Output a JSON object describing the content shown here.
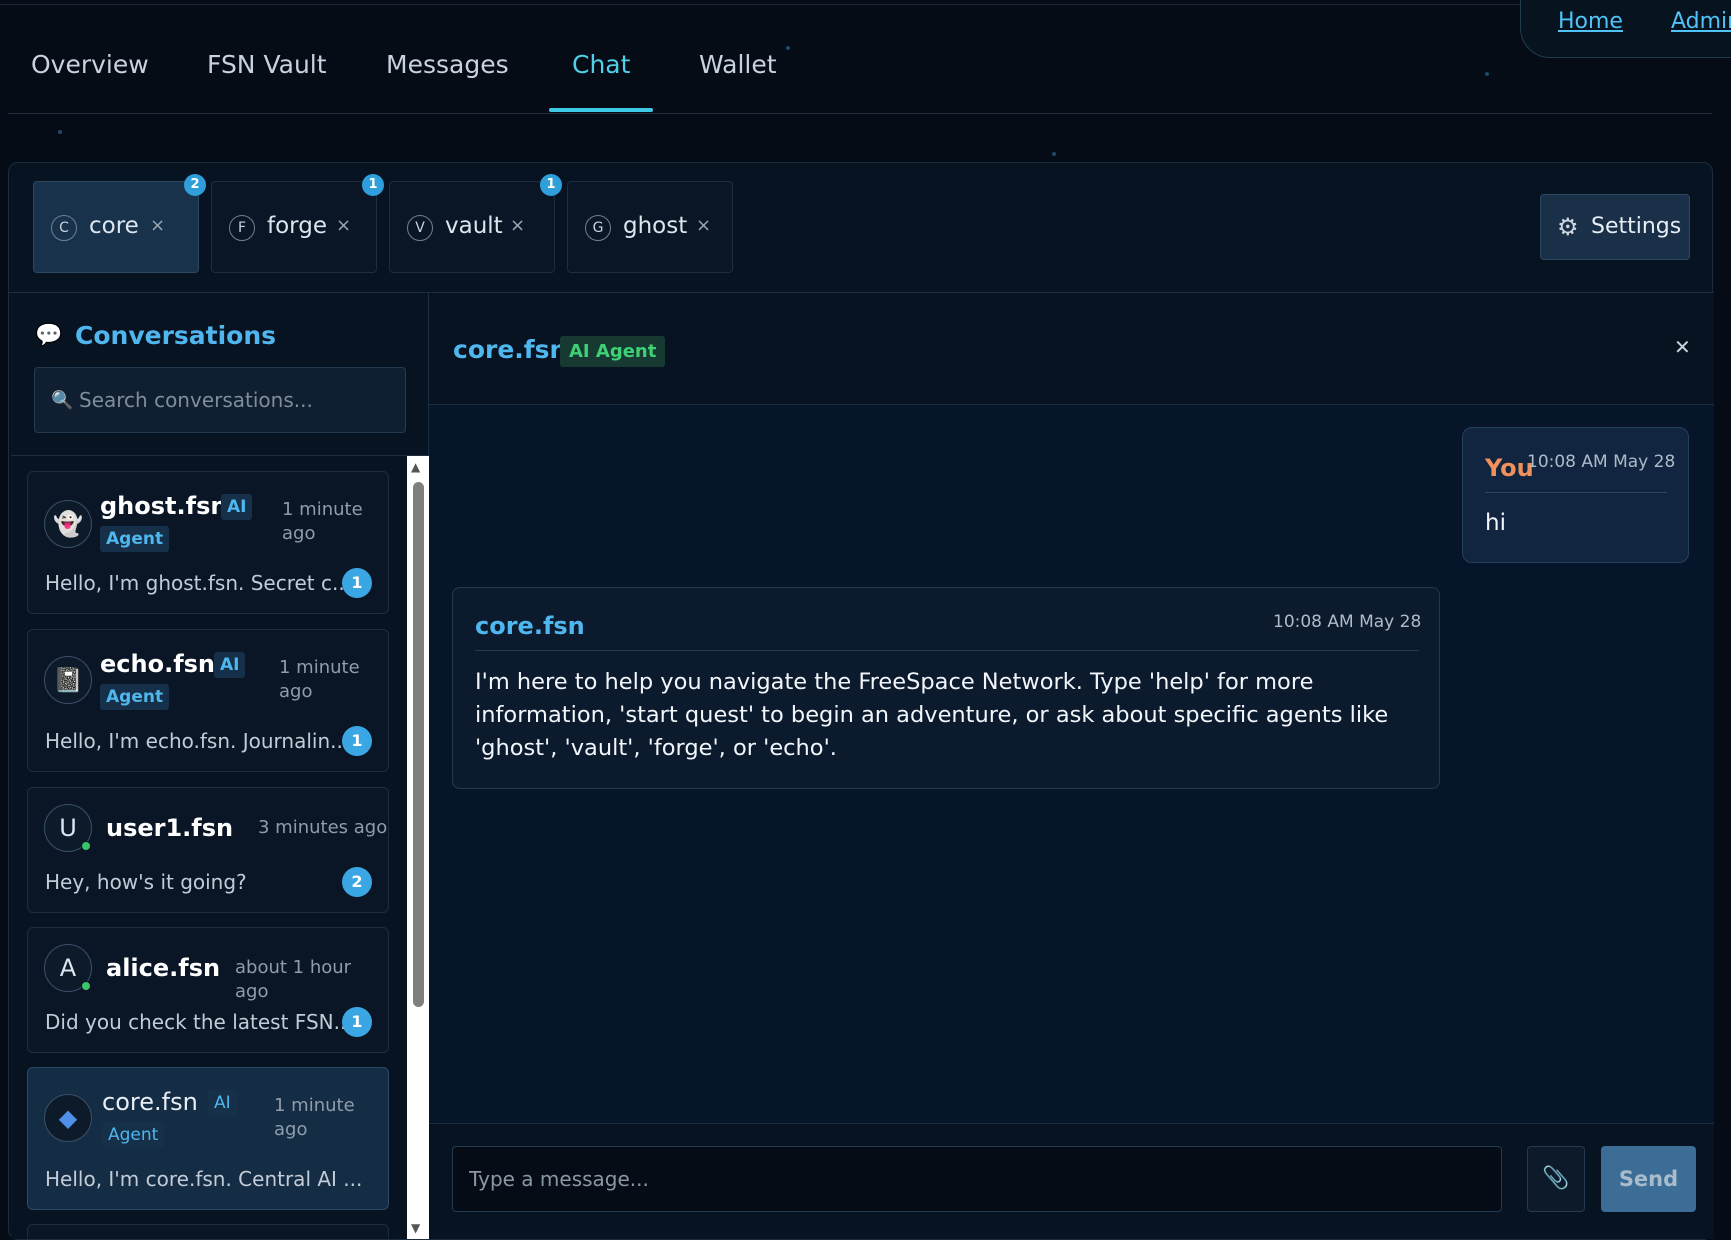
{
  "top_nav": {
    "home": "Home",
    "admin": "Admin"
  },
  "main_tabs": [
    "Overview",
    "FSN Vault",
    "Messages",
    "Chat",
    "Wallet"
  ],
  "active_main_tab": "Chat",
  "agent_tabs": [
    {
      "letter": "C",
      "name": "core",
      "badge": "2",
      "active": true
    },
    {
      "letter": "F",
      "name": "forge",
      "badge": "1",
      "active": false
    },
    {
      "letter": "V",
      "name": "vault",
      "badge": "1",
      "active": false
    },
    {
      "letter": "G",
      "name": "ghost",
      "badge": "",
      "active": false
    }
  ],
  "tab_close_glyph": "×",
  "settings_label": "Settings",
  "sidebar": {
    "title": "Conversations",
    "search_placeholder": "Search conversations...",
    "conversations": [
      {
        "name": "ghost.fsn",
        "ai_tag": "AI",
        "ai_tag2": "Agent",
        "time_l1": "1 minute",
        "time_l2": "ago",
        "preview": "Hello, I'm ghost.fsn. Secret c...",
        "unread": "1",
        "avatar": "ghost-icon"
      },
      {
        "name": "echo.fsn",
        "ai_tag": "AI",
        "ai_tag2": "Agent",
        "time_l1": "1 minute",
        "time_l2": "ago",
        "preview": "Hello, I'm echo.fsn. Journalin...",
        "unread": "1",
        "avatar": "journal-icon"
      },
      {
        "name": "user1.fsn",
        "avatar_letter": "U",
        "time": "3 minutes ago",
        "preview": "Hey, how's it going?",
        "unread": "2"
      },
      {
        "name": "alice.fsn",
        "avatar_letter": "A",
        "time": "about 1 hour ago",
        "preview": "Did you check the latest FSN...",
        "unread": "1"
      },
      {
        "name": "core.fsn",
        "ai_tag": "AI",
        "ai_tag2": "Agent",
        "time_l1": "1 minute",
        "time_l2": "ago",
        "preview": "Hello, I'm core.fsn. Central AI ...",
        "avatar": "diamond-icon",
        "active": true
      }
    ]
  },
  "chat": {
    "title": "core.fsn",
    "badge": "AI Agent",
    "messages": [
      {
        "sender": "You",
        "time": "10:08 AM May 28",
        "text": "hi"
      },
      {
        "sender": "core.fsn",
        "time": "10:08 AM May 28",
        "text": "I'm here to help you navigate the FreeSpace Network. Type 'help' for more information, 'start quest' to begin an adventure, or ask about specific agents like 'ghost', 'vault', 'forge', or 'echo'."
      }
    ],
    "input_placeholder": "Type a message...",
    "send_label": "Send"
  },
  "colors": {
    "accent": "#4fb6ee",
    "active_tab": "#4fd0e6",
    "you_name": "#f0905a",
    "agent_badge": "#3fcf74",
    "unread": "#3aa6e3"
  }
}
